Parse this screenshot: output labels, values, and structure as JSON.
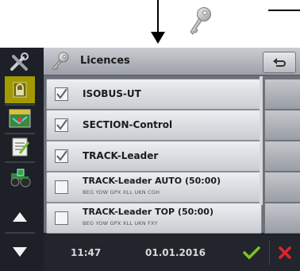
{
  "window": {
    "title": "Licences"
  },
  "licences": [
    {
      "label": "ISOBUS-UT",
      "sub": "",
      "checked": true
    },
    {
      "label": "SECTION-Control",
      "sub": "",
      "checked": true
    },
    {
      "label": "TRACK-Leader",
      "sub": "",
      "checked": true
    },
    {
      "label": "TRACK-Leader AUTO (50:00)",
      "sub": "BEG YOW GPX XLL UKN CGH",
      "checked": false
    },
    {
      "label": "TRACK-Leader TOP (50:00)",
      "sub": "BEG YOW GPX XLL UKN FXY",
      "checked": false
    }
  ],
  "status": {
    "time": "11:47",
    "date": "01.01.2016"
  },
  "icons": {
    "header": "key-icon",
    "annotation": "key-icon",
    "back": "return-arrow-icon",
    "ok": "checkmark-icon",
    "cancel": "cross-icon"
  },
  "colors": {
    "ok": "#7fc31c",
    "cancel": "#e2232a",
    "accent": "#b8b000"
  }
}
